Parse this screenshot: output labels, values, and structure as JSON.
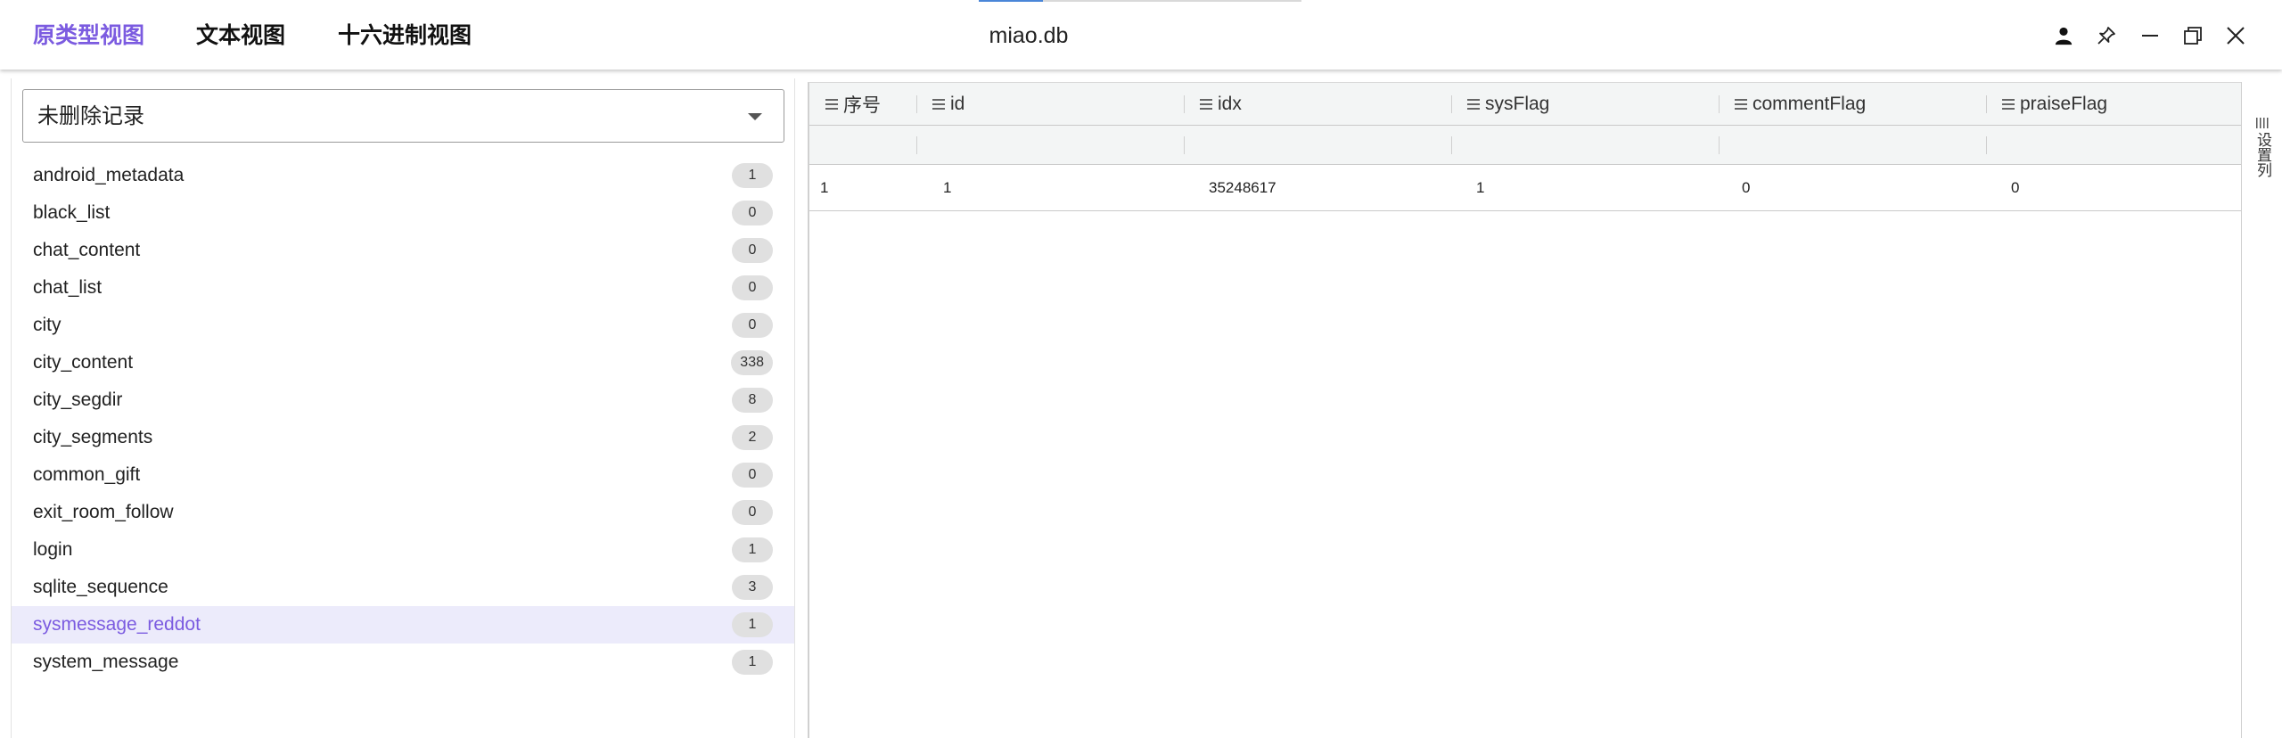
{
  "header": {
    "tabs": [
      {
        "label": "原类型视图",
        "active": true
      },
      {
        "label": "文本视图",
        "active": false
      },
      {
        "label": "十六进制视图",
        "active": false
      }
    ],
    "window_title": "miao.db",
    "icons": [
      "user-icon",
      "pin-icon",
      "minimize-icon",
      "restore-icon",
      "close-icon"
    ]
  },
  "colors": {
    "accent": "#7b5be0",
    "selected_bg": "#ecebfb",
    "badge_bg": "#e0e0e0",
    "grid_header_bg": "#f3f5f5"
  },
  "sidebar": {
    "filter_value": "未删除记录",
    "tables": [
      {
        "name": "android_metadata",
        "count": "1"
      },
      {
        "name": "black_list",
        "count": "0"
      },
      {
        "name": "chat_content",
        "count": "0"
      },
      {
        "name": "chat_list",
        "count": "0"
      },
      {
        "name": "city",
        "count": "0"
      },
      {
        "name": "city_content",
        "count": "338"
      },
      {
        "name": "city_segdir",
        "count": "8"
      },
      {
        "name": "city_segments",
        "count": "2"
      },
      {
        "name": "common_gift",
        "count": "0"
      },
      {
        "name": "exit_room_follow",
        "count": "0"
      },
      {
        "name": "login",
        "count": "1"
      },
      {
        "name": "sqlite_sequence",
        "count": "3"
      },
      {
        "name": "sysmessage_reddot",
        "count": "1",
        "selected": true
      },
      {
        "name": "system_message",
        "count": "1"
      }
    ]
  },
  "grid": {
    "columns": [
      "序号",
      "id",
      "idx",
      "sysFlag",
      "commentFlag",
      "praiseFlag"
    ],
    "rows": [
      [
        "1",
        "1",
        "35248617",
        "1",
        "0",
        "0"
      ]
    ],
    "side_button_label": "设置列"
  }
}
